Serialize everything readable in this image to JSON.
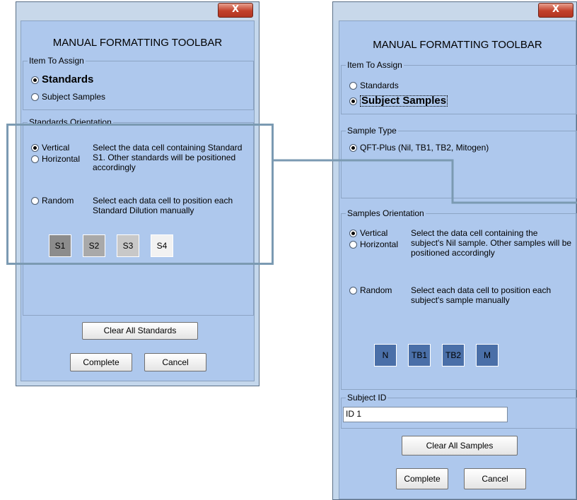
{
  "left_window": {
    "close_glyph": "X",
    "title": "MANUAL FORMATTING TOOLBAR",
    "item_group_label": "Item To Assign",
    "item_standards": "Standards",
    "item_subject_samples": "Subject Samples",
    "orientation_group_label": "Standards Orientation",
    "vertical": "Vertical",
    "horizontal": "Horizontal",
    "vertical_desc": "Select the data cell containing Standard S1. Other standards will be positioned accordingly",
    "random": "Random",
    "random_desc": "Select each data cell to position each Standard Dilution manually",
    "standards_buttons": [
      "S1",
      "S2",
      "S3",
      "S4"
    ],
    "clear_button": "Clear All Standards",
    "complete_button": "Complete",
    "cancel_button": "Cancel"
  },
  "right_window": {
    "close_glyph": "X",
    "title": "MANUAL FORMATTING TOOLBAR",
    "item_group_label": "Item To Assign",
    "item_standards": "Standards",
    "item_subject_samples": "Subject Samples",
    "sample_type_label": "Sample Type",
    "sample_type_option": "QFT-Plus (Nil, TB1, TB2, Mitogen)",
    "orientation_group_label": "Samples Orientation",
    "vertical": "Vertical",
    "horizontal": "Horizontal",
    "vertical_desc": "Select the data cell containing the subject's Nil sample. Other samples will be positioned accordingly",
    "random": "Random",
    "random_desc": "Select each data cell to position each subject's sample manually",
    "sample_buttons": [
      "N",
      "TB1",
      "TB2",
      "M"
    ],
    "subject_id_label": "Subject ID",
    "subject_id_value": "ID 1",
    "clear_button": "Clear All Samples",
    "complete_button": "Complete",
    "cancel_button": "Cancel"
  },
  "colors": {
    "panel": "#aec8ed",
    "s1": "#8c8c8c",
    "s2": "#a9a9a9",
    "s3": "#c8c8c8",
    "s4": "#f2f2f2",
    "sample_button": "#4a6fa8",
    "overlay": "#7b9ab2"
  }
}
